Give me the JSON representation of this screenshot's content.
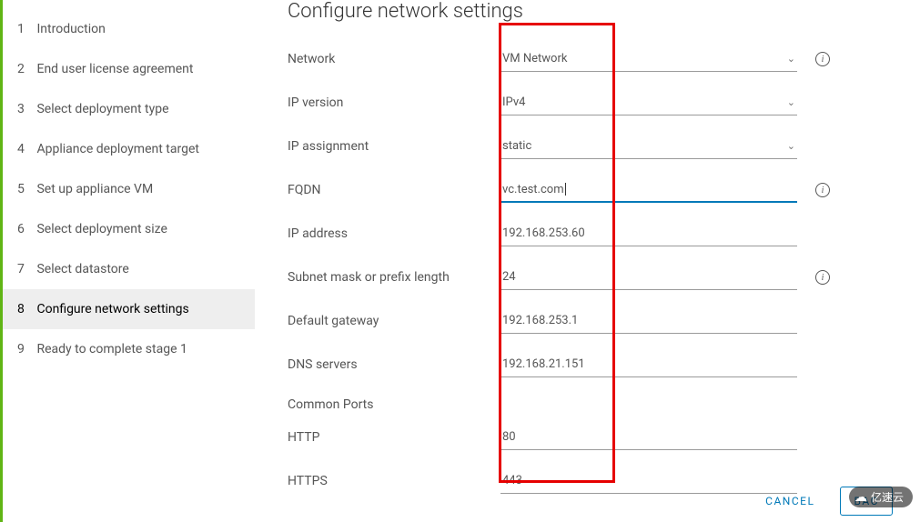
{
  "sidebar": {
    "items": [
      {
        "num": "1",
        "label": "Introduction"
      },
      {
        "num": "2",
        "label": "End user license agreement"
      },
      {
        "num": "3",
        "label": "Select deployment type"
      },
      {
        "num": "4",
        "label": "Appliance deployment target"
      },
      {
        "num": "5",
        "label": "Set up appliance VM"
      },
      {
        "num": "6",
        "label": "Select deployment size"
      },
      {
        "num": "7",
        "label": "Select datastore"
      },
      {
        "num": "8",
        "label": "Configure network settings"
      },
      {
        "num": "9",
        "label": "Ready to complete stage 1"
      }
    ],
    "active_index": 7
  },
  "page": {
    "title": "Configure network settings"
  },
  "form": {
    "network": {
      "label": "Network",
      "value": "VM Network"
    },
    "ip_version": {
      "label": "IP version",
      "value": "IPv4"
    },
    "ip_assignment": {
      "label": "IP assignment",
      "value": "static"
    },
    "fqdn": {
      "label": "FQDN",
      "value": "vc.test.com"
    },
    "ip_address": {
      "label": "IP address",
      "value": "192.168.253.60"
    },
    "subnet": {
      "label": "Subnet mask or prefix length",
      "value": "24"
    },
    "gateway": {
      "label": "Default gateway",
      "value": "192.168.253.1"
    },
    "dns": {
      "label": "DNS servers",
      "value": "192.168.21.151"
    },
    "section_ports": "Common Ports",
    "http": {
      "label": "HTTP",
      "value": "80"
    },
    "https": {
      "label": "HTTPS",
      "value": "443"
    }
  },
  "footer": {
    "cancel": "CANCEL",
    "back": "BAC"
  },
  "watermark": "亿速云"
}
